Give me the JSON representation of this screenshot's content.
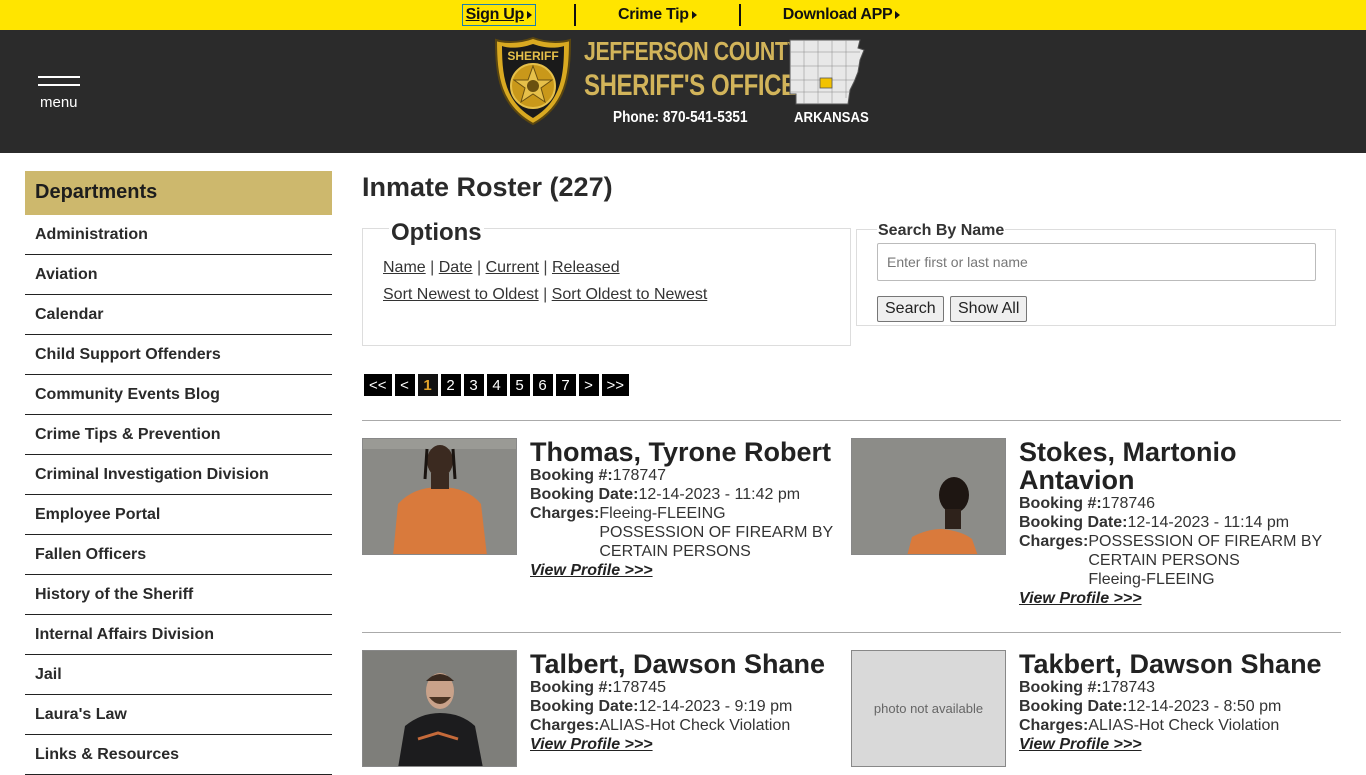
{
  "topbar": {
    "signup": "Sign Up",
    "crime_tip": "Crime Tip",
    "download_app": "Download APP"
  },
  "header": {
    "menu_label": "menu",
    "title_line1": "JEFFERSON COUNTY",
    "title_line2": "SHERIFF'S OFFICE",
    "phone": "Phone: 870-541-5351",
    "state": "ARKANSAS",
    "badge_text": "SHERIFF",
    "colors": {
      "bar": "#ffe500",
      "header_bg": "#2b2b2b",
      "gold": "#d2b45a"
    }
  },
  "sidebar": {
    "heading": "Departments",
    "items": [
      "Administration",
      "Aviation",
      "Calendar",
      "Child Support Offenders",
      "Community Events Blog",
      "Crime Tips & Prevention",
      "Criminal Investigation Division",
      "Employee Portal",
      "Fallen Officers",
      "History of the Sheriff",
      "Internal Affairs Division",
      "Jail",
      "Laura's Law",
      "Links & Resources"
    ]
  },
  "main": {
    "title": "Inmate Roster (227)",
    "options": {
      "heading": "Options",
      "sort_by": [
        "Name",
        "Date",
        "Current",
        "Released"
      ],
      "sort_order": [
        "Sort Newest to Oldest",
        "Sort Oldest to Newest"
      ]
    },
    "search": {
      "label": "Search By Name",
      "placeholder": "Enter first or last name",
      "search_button": "Search",
      "show_all_button": "Show All"
    },
    "pager": {
      "first": "<<",
      "prev": "<",
      "pages": [
        "1",
        "2",
        "3",
        "4",
        "5",
        "6",
        "7"
      ],
      "current": "1",
      "next": ">",
      "last": ">>"
    },
    "labels": {
      "booking_no": "Booking #:",
      "booking_date": "Booking Date:",
      "charges": "Charges:",
      "view_profile": "View Profile >>>",
      "no_photo": "photo not available"
    },
    "inmates": [
      {
        "name": "Thomas, Tyrone Robert",
        "booking_no": "178747",
        "booking_date": "12-14-2023 - 11:42 pm",
        "charges": [
          "Fleeing-FLEEING",
          "POSSESSION OF FIREARM BY CERTAIN PERSONS"
        ]
      },
      {
        "name": "Stokes, Martonio Antavion",
        "booking_no": "178746",
        "booking_date": "12-14-2023 - 11:14 pm",
        "charges": [
          "POSSESSION OF FIREARM BY CERTAIN PERSONS",
          "Fleeing-FLEEING"
        ]
      },
      {
        "name": "Talbert, Dawson Shane",
        "booking_no": "178745",
        "booking_date": "12-14-2023 - 9:19 pm",
        "charges": [
          "ALIAS-Hot Check Violation"
        ]
      },
      {
        "name": "Takbert, Dawson Shane",
        "booking_no": "178743",
        "booking_date": "12-14-2023 - 8:50 pm",
        "charges": [
          "ALIAS-Hot Check Violation"
        ]
      }
    ]
  }
}
